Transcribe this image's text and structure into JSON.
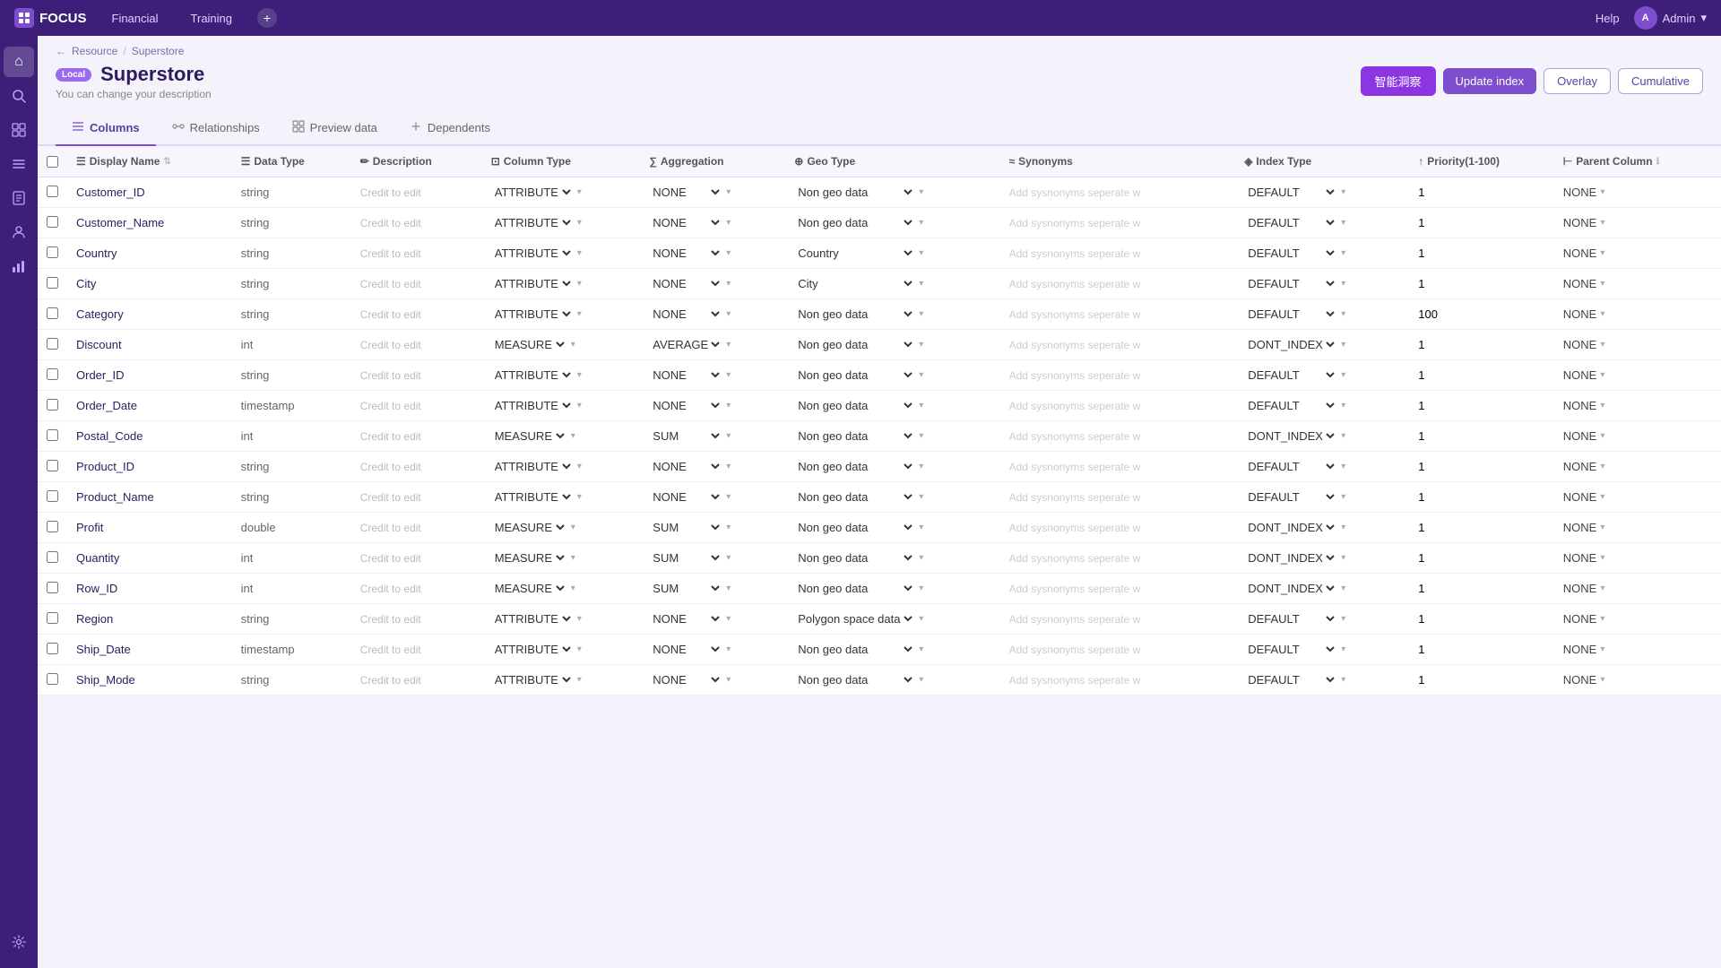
{
  "topbar": {
    "logo": "FOCUS",
    "nav": [
      "Financial",
      "Training"
    ],
    "help": "Help",
    "user": "Admin"
  },
  "breadcrumb": {
    "resource": "Resource",
    "superstore": "Superstore"
  },
  "page": {
    "badge": "Local",
    "title": "Superstore",
    "subtitle": "You can change your description",
    "btn_ai": "智能洞察",
    "btn_update": "Update index",
    "btn_overlay": "Overlay",
    "btn_cumulative": "Cumulative"
  },
  "tabs": [
    {
      "id": "columns",
      "label": "Columns",
      "icon": "≡",
      "active": true
    },
    {
      "id": "relationships",
      "label": "Relationships",
      "icon": "⇄",
      "active": false
    },
    {
      "id": "preview",
      "label": "Preview data",
      "icon": "▦",
      "active": false
    },
    {
      "id": "dependents",
      "label": "Dependents",
      "icon": "⋯",
      "active": false
    }
  ],
  "table": {
    "columns": [
      {
        "key": "checkbox",
        "label": ""
      },
      {
        "key": "display_name",
        "label": "Display Name",
        "sortable": true
      },
      {
        "key": "data_type",
        "label": "Data Type"
      },
      {
        "key": "description",
        "label": "Description"
      },
      {
        "key": "column_type",
        "label": "Column Type"
      },
      {
        "key": "aggregation",
        "label": "Aggregation"
      },
      {
        "key": "geo_type",
        "label": "Geo Type"
      },
      {
        "key": "synonyms",
        "label": "Synonyms"
      },
      {
        "key": "index_type",
        "label": "Index Type"
      },
      {
        "key": "priority",
        "label": "Priority(1-100)"
      },
      {
        "key": "parent_column",
        "label": "Parent Column"
      }
    ],
    "rows": [
      {
        "display_name": "Customer_ID",
        "data_type": "string",
        "description": "Credit to edit",
        "column_type": "ATTRIBUTE",
        "aggregation": "NONE",
        "geo_type": "Non geo data",
        "synonyms": "",
        "index_type": "DEFAULT",
        "priority": "1",
        "parent_column": "NONE"
      },
      {
        "display_name": "Customer_Name",
        "data_type": "string",
        "description": "Credit to edit",
        "column_type": "ATTRIBUTE",
        "aggregation": "NONE",
        "geo_type": "Non geo data",
        "synonyms": "",
        "index_type": "DEFAULT",
        "priority": "1",
        "parent_column": "NONE"
      },
      {
        "display_name": "Country",
        "data_type": "string",
        "description": "Credit to edit",
        "column_type": "ATTRIBUTE",
        "aggregation": "NONE",
        "geo_type": "Country",
        "synonyms": "",
        "index_type": "DEFAULT",
        "priority": "1",
        "parent_column": "NONE"
      },
      {
        "display_name": "City",
        "data_type": "string",
        "description": "Credit to edit",
        "column_type": "ATTRIBUTE",
        "aggregation": "NONE",
        "geo_type": "City",
        "synonyms": "",
        "index_type": "DEFAULT",
        "priority": "1",
        "parent_column": "NONE"
      },
      {
        "display_name": "Category",
        "data_type": "string",
        "description": "Credit to edit",
        "column_type": "ATTRIBUTE",
        "aggregation": "NONE",
        "geo_type": "Non geo data",
        "synonyms": "",
        "index_type": "DEFAULT",
        "priority": "100",
        "parent_column": "NONE"
      },
      {
        "display_name": "Discount",
        "data_type": "int",
        "description": "Credit to edit",
        "column_type": "MEASURE",
        "aggregation": "AVERAGE",
        "geo_type": "Non geo data",
        "synonyms": "",
        "index_type": "DONT_INDEX",
        "priority": "1",
        "parent_column": "NONE"
      },
      {
        "display_name": "Order_ID",
        "data_type": "string",
        "description": "Credit to edit",
        "column_type": "ATTRIBUTE",
        "aggregation": "NONE",
        "geo_type": "Non geo data",
        "synonyms": "",
        "index_type": "DEFAULT",
        "priority": "1",
        "parent_column": "NONE"
      },
      {
        "display_name": "Order_Date",
        "data_type": "timestamp",
        "description": "Credit to edit",
        "column_type": "ATTRIBUTE",
        "aggregation": "NONE",
        "geo_type": "Non geo data",
        "synonyms": "",
        "index_type": "DEFAULT",
        "priority": "1",
        "parent_column": "NONE"
      },
      {
        "display_name": "Postal_Code",
        "data_type": "int",
        "description": "Credit to edit",
        "column_type": "MEASURE",
        "aggregation": "SUM",
        "geo_type": "Non geo data",
        "synonyms": "",
        "index_type": "DONT_INDEX",
        "priority": "1",
        "parent_column": "NONE"
      },
      {
        "display_name": "Product_ID",
        "data_type": "string",
        "description": "Credit to edit",
        "column_type": "ATTRIBUTE",
        "aggregation": "NONE",
        "geo_type": "Non geo data",
        "synonyms": "",
        "index_type": "DEFAULT",
        "priority": "1",
        "parent_column": "NONE"
      },
      {
        "display_name": "Product_Name",
        "data_type": "string",
        "description": "Credit to edit",
        "column_type": "ATTRIBUTE",
        "aggregation": "NONE",
        "geo_type": "Non geo data",
        "synonyms": "",
        "index_type": "DEFAULT",
        "priority": "1",
        "parent_column": "NONE"
      },
      {
        "display_name": "Profit",
        "data_type": "double",
        "description": "Credit to edit",
        "column_type": "MEASURE",
        "aggregation": "SUM",
        "geo_type": "Non geo data",
        "synonyms": "",
        "index_type": "DONT_INDEX",
        "priority": "1",
        "parent_column": "NONE"
      },
      {
        "display_name": "Quantity",
        "data_type": "int",
        "description": "Credit to edit",
        "column_type": "MEASURE",
        "aggregation": "SUM",
        "geo_type": "Non geo data",
        "synonyms": "",
        "index_type": "DONT_INDEX",
        "priority": "1",
        "parent_column": "NONE"
      },
      {
        "display_name": "Row_ID",
        "data_type": "int",
        "description": "Credit to edit",
        "column_type": "MEASURE",
        "aggregation": "SUM",
        "geo_type": "Non geo data",
        "synonyms": "",
        "index_type": "DONT_INDEX",
        "priority": "1",
        "parent_column": "NONE"
      },
      {
        "display_name": "Region",
        "data_type": "string",
        "description": "Credit to edit",
        "column_type": "ATTRIBUTE",
        "aggregation": "NONE",
        "geo_type": "Polygon space data",
        "synonyms": "",
        "index_type": "DEFAULT",
        "priority": "1",
        "parent_column": "NONE"
      },
      {
        "display_name": "Ship_Date",
        "data_type": "timestamp",
        "description": "Credit to edit",
        "column_type": "ATTRIBUTE",
        "aggregation": "NONE",
        "geo_type": "Non geo data",
        "synonyms": "",
        "index_type": "DEFAULT",
        "priority": "1",
        "parent_column": "NONE"
      },
      {
        "display_name": "Ship_Mode",
        "data_type": "string",
        "description": "Credit to edit",
        "column_type": "ATTRIBUTE",
        "aggregation": "NONE",
        "geo_type": "Non geo data",
        "synonyms": "",
        "index_type": "DEFAULT",
        "priority": "1",
        "parent_column": "NONE"
      }
    ]
  },
  "icons": {
    "logo": "◈",
    "home": "⌂",
    "search": "🔍",
    "grid": "▦",
    "menu": "☰",
    "book": "📖",
    "person": "👤",
    "chart": "📊",
    "settings": "⚙",
    "columns_tab": "≡",
    "relationships_tab": "⇄",
    "preview_tab": "▦",
    "dependents_tab": "⋯"
  },
  "synonyms_placeholder": "Add sysnonyms seperate w"
}
